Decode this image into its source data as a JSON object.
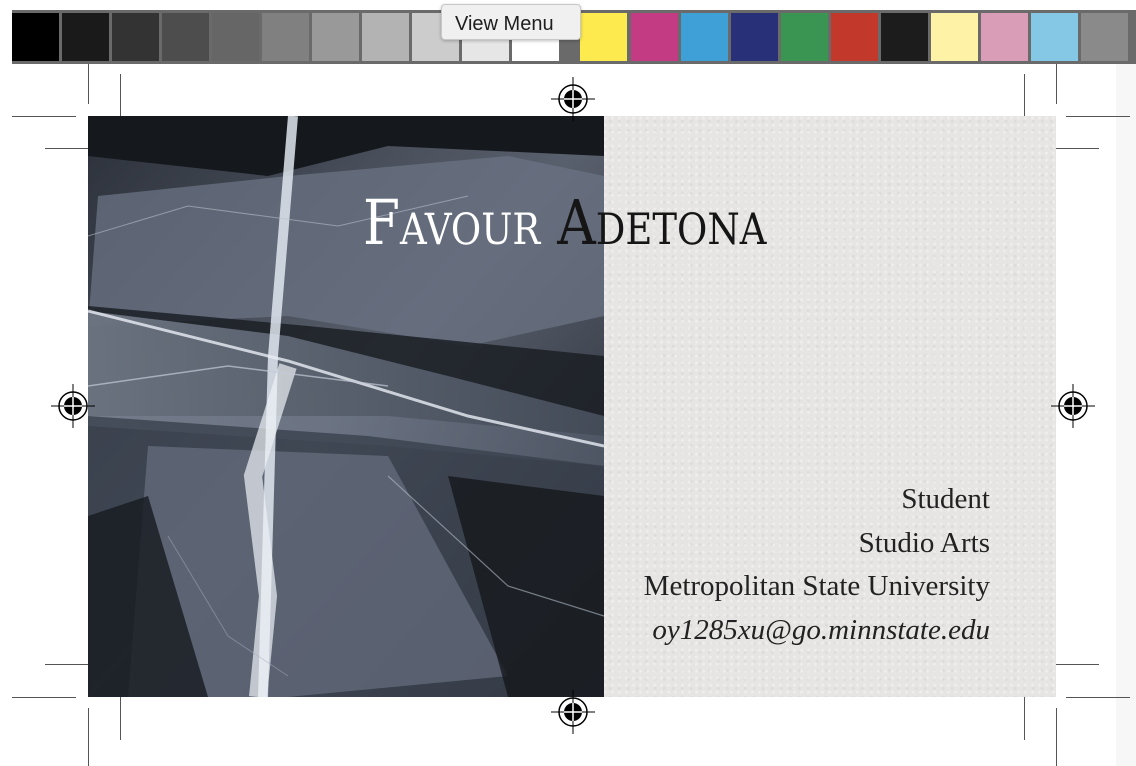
{
  "toolbar": {
    "tooltip": "View Menu",
    "swatches": [
      "#000000",
      "#1a1a1a",
      "#333333",
      "#4d4d4d",
      "#666666",
      "#808080",
      "#999999",
      "#b3b3b3",
      "#cccccc",
      "#e6e6e6",
      "#ffffff",
      "#fdea4f",
      "#c33b82",
      "#3fa0d8",
      "#283077",
      "#3a9452",
      "#c2392c",
      "#1c1c1c",
      "#fdf2a6",
      "#d99db8",
      "#85c8e6",
      "#8a8a8a"
    ]
  },
  "card": {
    "first_name": "Favour",
    "last_name": "Adetona",
    "role": "Student",
    "department": "Studio Arts",
    "school": "Metropolitan State University",
    "email": "oy1285xu@go.minnstate.edu"
  },
  "colors": {
    "paper": "#e6e5e3",
    "ice_dark": "#1d2126",
    "ice_light": "#c9d0da"
  }
}
